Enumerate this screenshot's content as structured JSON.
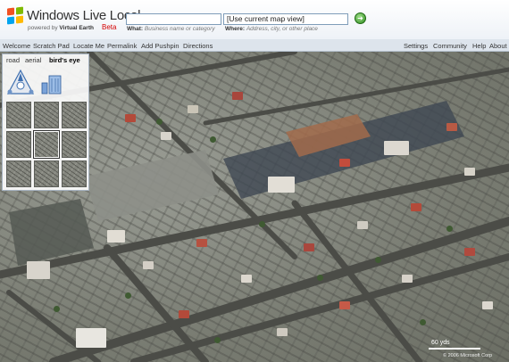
{
  "header": {
    "brand": "Windows Live Local",
    "powered_by": "powered by",
    "powered_brand": "Virtual Earth",
    "beta": "Beta",
    "what_label": "What:",
    "what_hint": "Business name or category",
    "where_value": "[Use current map view]",
    "where_label": "Where:",
    "where_hint": "Address, city, or other place"
  },
  "menu_left": [
    "Welcome",
    "Scratch Pad",
    "Locate Me",
    "Permalink",
    "Add Pushpin",
    "Directions"
  ],
  "menu_right": [
    "Settings",
    "Community",
    "Help",
    "About"
  ],
  "map_panel": {
    "tabs": [
      "road",
      "aerial",
      "bird's eye"
    ],
    "active_tab": "bird's eye"
  },
  "map": {
    "scale_label": "60 yds",
    "copyright": "© 2006 Microsoft Corp"
  },
  "colors": {
    "logo_red": "#f25022",
    "logo_green": "#7fba00",
    "logo_blue": "#00a4ef",
    "logo_yellow": "#ffb900",
    "beta_red": "#d40000"
  }
}
